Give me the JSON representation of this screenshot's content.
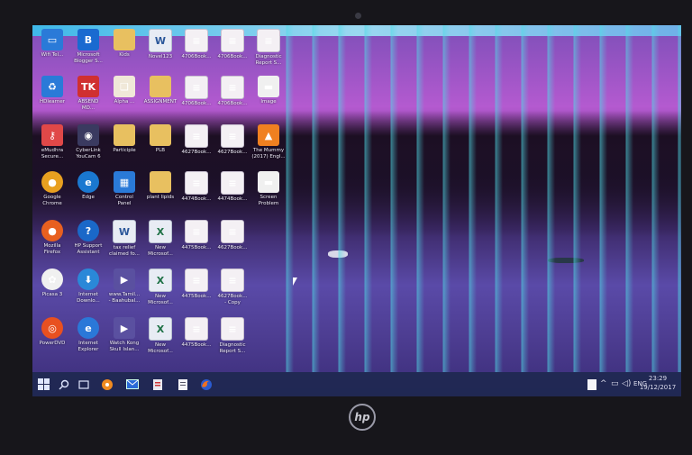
{
  "desktop": {
    "icons": [
      {
        "id": "r1c1",
        "label": "Wifi Tel...",
        "icon": "monitor-icon",
        "color": "#2a7ad8"
      },
      {
        "id": "r1c2",
        "label": "Microsoft\nBlogger S...",
        "icon": "blogger-icon",
        "color": "#1a6ad0"
      },
      {
        "id": "r1c3",
        "label": "Kids",
        "icon": "folder-icon",
        "color": "#e8c060"
      },
      {
        "id": "r1c4",
        "label": "Novel123",
        "icon": "word-doc-icon",
        "color": "#2b579a"
      },
      {
        "id": "r1c5",
        "label": "4706Book...",
        "icon": "document-icon",
        "color": "#f4f0f4"
      },
      {
        "id": "r1c6",
        "label": "4706Book...",
        "icon": "document-icon",
        "color": "#f4f0f4"
      },
      {
        "id": "r1c7",
        "label": "Diagnostic\nReport S...",
        "icon": "document-icon",
        "color": "#f4f0f4"
      },
      {
        "id": "r2c1",
        "label": "HDlearner",
        "icon": "recycle-icon",
        "color": "#2a7ad8"
      },
      {
        "id": "r2c2",
        "label": "ABSEND\nMD...",
        "icon": "tk-icon",
        "color": "#d03030"
      },
      {
        "id": "r2c3",
        "label": "Alpha ...",
        "icon": "book-icon",
        "color": "#f0e8d8"
      },
      {
        "id": "r2c4",
        "label": "ASSIGNMENT",
        "icon": "folder-icon",
        "color": "#e8c060"
      },
      {
        "id": "r2c5",
        "label": "4706Book...",
        "icon": "document-icon",
        "color": "#f4f0f4"
      },
      {
        "id": "r2c6",
        "label": "4706Book...",
        "icon": "document-icon",
        "color": "#f4f0f4"
      },
      {
        "id": "r2c7",
        "label": "Image",
        "icon": "image-icon",
        "color": "#f0f0f0"
      },
      {
        "id": "r3c1",
        "label": "eMudhra\nSecure...",
        "icon": "key-icon",
        "color": "#e04848"
      },
      {
        "id": "r3c2",
        "label": "CyberLink\nYouCam 6",
        "icon": "webcam-icon",
        "color": "#3a3a60"
      },
      {
        "id": "r3c3",
        "label": "Participle",
        "icon": "folder-icon",
        "color": "#e8c060"
      },
      {
        "id": "r3c4",
        "label": "PLB",
        "icon": "folder-icon",
        "color": "#e8c060"
      },
      {
        "id": "r3c5",
        "label": "4627Book...",
        "icon": "document-icon",
        "color": "#f4f0f4"
      },
      {
        "id": "r3c6",
        "label": "4627Book...",
        "icon": "document-icon",
        "color": "#f4f0f4"
      },
      {
        "id": "r3c7",
        "label": "The Mummy\n(2017) Engl...",
        "icon": "vlc-icon",
        "color": "#f08020"
      },
      {
        "id": "r4c1",
        "label": "Google\nChrome",
        "icon": "chrome-icon",
        "color": "#e8a020"
      },
      {
        "id": "r4c2",
        "label": "Edge",
        "icon": "edge-icon",
        "color": "#1a78d0"
      },
      {
        "id": "r4c3",
        "label": "Control\nPanel",
        "icon": "control-panel-icon",
        "color": "#2a7ad8"
      },
      {
        "id": "r4c4",
        "label": "plant lipids",
        "icon": "folder-icon",
        "color": "#e8c060"
      },
      {
        "id": "r4c5",
        "label": "4474Book...",
        "icon": "document-icon",
        "color": "#f4f0f4"
      },
      {
        "id": "r4c6",
        "label": "4474Book...",
        "icon": "document-icon",
        "color": "#f4f0f4"
      },
      {
        "id": "r4c7",
        "label": "Screen\nProblem",
        "icon": "image-icon",
        "color": "#f0f0f0"
      },
      {
        "id": "r5c1",
        "label": "Mozilla\nFirefox",
        "icon": "firefox-icon",
        "color": "#e86020"
      },
      {
        "id": "r5c2",
        "label": "HP Support\nAssistant",
        "icon": "help-icon",
        "color": "#1a68c8"
      },
      {
        "id": "r5c3",
        "label": "tax relief\nclaimed fo...",
        "icon": "word-doc-icon",
        "color": "#2b579a"
      },
      {
        "id": "r5c4",
        "label": "New\nMicrosof...",
        "icon": "excel-doc-icon",
        "color": "#1e7145"
      },
      {
        "id": "r5c5",
        "label": "4475Book...",
        "icon": "document-icon",
        "color": "#f4f0f4"
      },
      {
        "id": "r5c6",
        "label": "4627Book...",
        "icon": "document-icon",
        "color": "#f4f0f4"
      },
      {
        "id": "r6c1",
        "label": "Picasa 3",
        "icon": "picasa-icon",
        "color": "#f0f0f0"
      },
      {
        "id": "r6c2",
        "label": "Internet\nDownlo...",
        "icon": "idm-icon",
        "color": "#2a88d8"
      },
      {
        "id": "r6c3",
        "label": "www.Tamil...\n- Baahubal...",
        "icon": "video-file-icon",
        "color": "#5a50a0"
      },
      {
        "id": "r6c4",
        "label": "New\nMicrosof...",
        "icon": "excel-doc-icon",
        "color": "#1e7145"
      },
      {
        "id": "r6c5",
        "label": "4475Book...",
        "icon": "document-icon",
        "color": "#f4f0f4"
      },
      {
        "id": "r6c6",
        "label": "4627Book...\n- Copy",
        "icon": "document-icon",
        "color": "#f4f0f4"
      },
      {
        "id": "r7c1",
        "label": "PowerDVD",
        "icon": "powerdvd-icon",
        "color": "#e85020"
      },
      {
        "id": "r7c2",
        "label": "Internet\nExplorer",
        "icon": "ie-icon",
        "color": "#2a78d8"
      },
      {
        "id": "r7c3",
        "label": "Watch Kong\nSkull Islan...",
        "icon": "video-file-icon",
        "color": "#5a50a0"
      },
      {
        "id": "r7c4",
        "label": "New\nMicrosof...",
        "icon": "excel-doc-icon",
        "color": "#1e7145"
      },
      {
        "id": "r7c5",
        "label": "4475Book...",
        "icon": "document-icon",
        "color": "#f4f0f4"
      },
      {
        "id": "r7c6",
        "label": "Diagnostic\nReport S...",
        "icon": "document-icon",
        "color": "#f4f0f4"
      }
    ]
  },
  "taskbar": {
    "start": "windows-icon",
    "search": "search-icon",
    "task_view": "task-view-icon",
    "pinned": [
      "media-player-icon",
      "mail-icon",
      "office-icon",
      "document-icon",
      "firefox-icon"
    ],
    "tray_icons": [
      "chevron-up-icon",
      "network-icon",
      "volume-icon",
      "keyboard-icon"
    ],
    "time": "23:29",
    "date": "19/12/2017"
  },
  "device": {
    "logo_text": "hp"
  }
}
